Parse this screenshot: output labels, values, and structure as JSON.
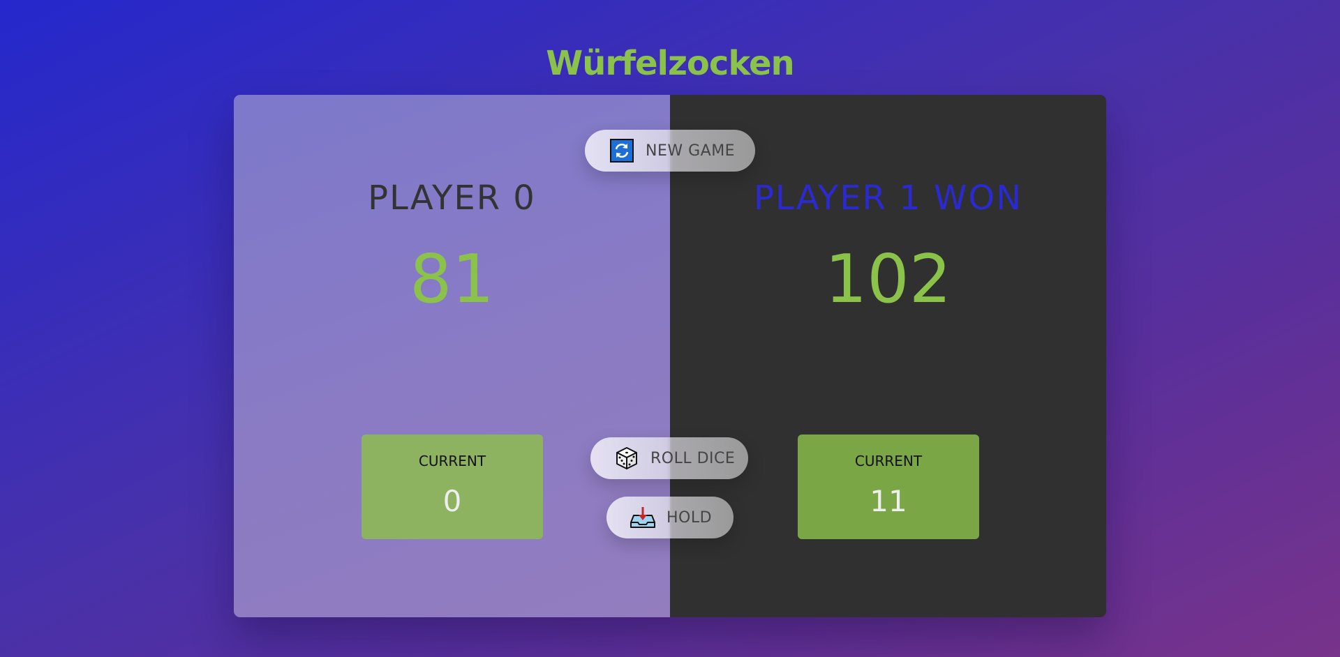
{
  "title": "Würfelzocken",
  "players": [
    {
      "name": "PLAYER 0",
      "score": "81",
      "current_label": "CURRENT",
      "current": "0",
      "active": false,
      "winner": false
    },
    {
      "name": "PLAYER 1 WON",
      "score": "102",
      "current_label": "CURRENT",
      "current": "11",
      "active": true,
      "winner": true
    }
  ],
  "buttons": {
    "new_game": {
      "label": "NEW GAME",
      "icon": "refresh-icon"
    },
    "roll_dice": {
      "label": "ROLL DICE",
      "icon": "dice-icon"
    },
    "hold": {
      "label": "HOLD",
      "icon": "inbox-tray-icon"
    }
  },
  "colors": {
    "title": "#8bc34a",
    "score": "#8bc34a",
    "winner_name": "#2a2ad0",
    "winner_panel": "#303030",
    "current_box_player0": "#8db360",
    "current_box_player1": "#7aa646"
  }
}
